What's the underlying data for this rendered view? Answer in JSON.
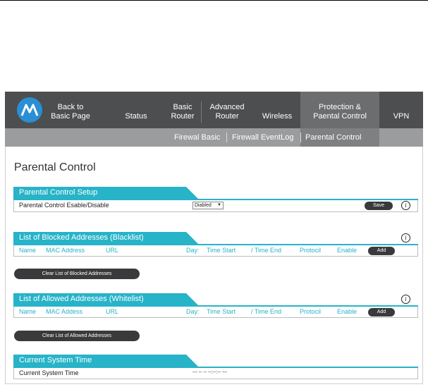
{
  "nav": {
    "items": [
      {
        "label_line1": "Back to",
        "label_line2": "Basic Page"
      },
      {
        "label_line1": "",
        "label_line2": "Status"
      },
      {
        "label_line1": "Basic",
        "label_line2": "Router"
      },
      {
        "label_line1": "Advanced",
        "label_line2": "Router"
      },
      {
        "label_line1": "",
        "label_line2": "Wireless"
      },
      {
        "label_line1": "Protection &",
        "label_line2": "Paental Control"
      },
      {
        "label_line1": "",
        "label_line2": "VPN"
      }
    ],
    "active_index": 5,
    "logo_icon": "motorola-logo-icon"
  },
  "subnav": {
    "items": [
      "Firewal Basic",
      "Firewall EventLog",
      "Parental Control"
    ],
    "active_index": 2
  },
  "page_title": "Parental Control",
  "setup": {
    "banner": "Parental Control Setup",
    "row_label": "Parental Control Esable/Disable",
    "select_value": "Diabled",
    "save_label": "Save"
  },
  "blacklist": {
    "banner": "List of Blocked Addresses (Blacklist)",
    "columns": [
      "Name",
      "MAC Address",
      "URL",
      "Day:",
      "Time Start",
      "/ Time End",
      "Protocil",
      "Enable"
    ],
    "add_label": "Add",
    "clear_label": "Clear List of Blocked Addresses"
  },
  "whitelist": {
    "banner": "List of Allowed Addresses (Whitelist)",
    "columns": [
      "Name",
      "MAC Addess",
      "URL",
      "Day:",
      "Time Start",
      "/ Time End",
      "Protocil",
      "Enable"
    ],
    "add_label": "Add",
    "clear_label": "Clear List of Allowed Addresses"
  },
  "system_time": {
    "banner": "Current System Time",
    "row_label": "Current System Time",
    "value": "--- -- -- --:--:-- ---"
  },
  "colors": {
    "accent": "#27b3c8",
    "nav_bg": "#4d4e50",
    "subnav_bg": "#9b9c9e",
    "button_bg": "#3a3a3c"
  }
}
